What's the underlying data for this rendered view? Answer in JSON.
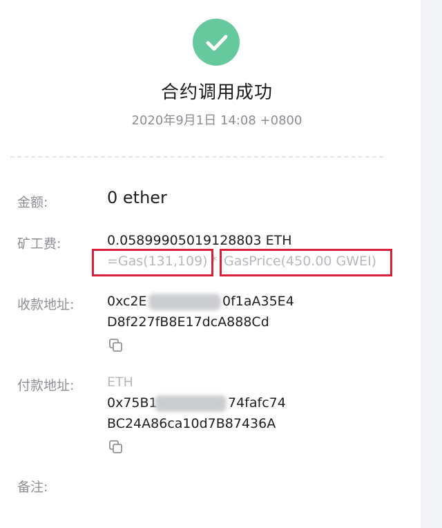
{
  "header": {
    "title": "合约调用成功",
    "timestamp": "2020年9月1日 14:08 +0800"
  },
  "details": {
    "amount_label": "金额:",
    "amount_value": "0 ether",
    "fee_label": "矿工费:",
    "fee_value": "0.05899905019128803 ETH",
    "gas_formula": "=Gas(131,109)",
    "gas_multiply": "*",
    "gas_price": "GasPrice(450.00 GWEI)",
    "receive_label": "收款地址:",
    "receive_line1_start": "0xc2E",
    "receive_line1_end": "0f1aA35E4",
    "receive_line2": "D8f227fB8E17dcA888Cd",
    "payer_label": "付款地址:",
    "payer_currency": "ETH",
    "payer_line1_start": "0x75B1",
    "payer_line1_end": "74fafc74",
    "payer_line2": "BC24A86ca10d7B87436A",
    "note_label": "备注:"
  },
  "icons": {
    "success": "check-circle-icon",
    "copy": "copy-icon"
  },
  "colors": {
    "success_green": "#66c99e",
    "highlight_red": "#d91e3a"
  }
}
